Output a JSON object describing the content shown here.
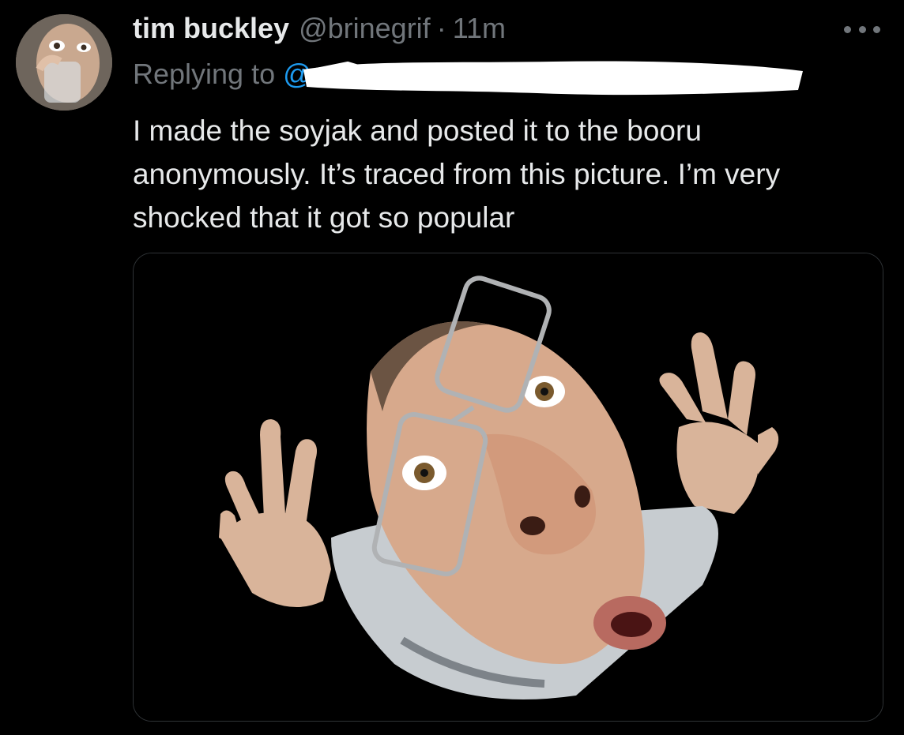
{
  "tweet": {
    "author_name": "tim buckley",
    "author_handle": "@brinegrif",
    "separator": "·",
    "timestamp": "11m",
    "replying_prefix": "Replying to",
    "replying_handle": "@",
    "text": "I made the soyjak and posted it to the booru anonymously. It’s traced from this picture. I’m very shocked that it got so popular",
    "more_icon": "more-horizontal-icon"
  },
  "colors": {
    "background": "#000000",
    "primary_text": "#e7e9ea",
    "secondary_text": "#71767b",
    "link": "#1d9bf0",
    "border": "#2f3336"
  }
}
